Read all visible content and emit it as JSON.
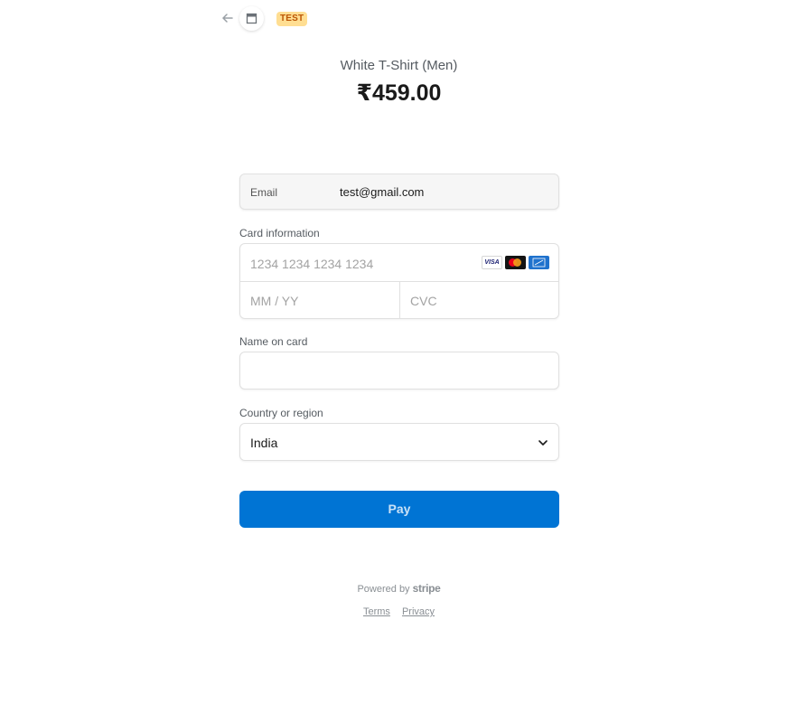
{
  "header": {
    "badge": "TEST"
  },
  "product": {
    "name": "White T-Shirt (Men)",
    "price": "₹459.00"
  },
  "email": {
    "label": "Email",
    "value": "test@gmail.com"
  },
  "card": {
    "label": "Card information",
    "number_placeholder": "1234 1234 1234 1234",
    "expiry_placeholder": "MM / YY",
    "cvc_placeholder": "CVC",
    "brands": [
      "visa",
      "mastercard",
      "amex"
    ],
    "visa_text": "VISA"
  },
  "name_on_card": {
    "label": "Name on card",
    "value": ""
  },
  "country": {
    "label": "Country or region",
    "selected": "India"
  },
  "pay_button": {
    "label": "Pay",
    "color": "#0074d4"
  },
  "footer": {
    "powered_by": "Powered by",
    "brand": "stripe",
    "terms": "Terms",
    "privacy": "Privacy"
  },
  "colors": {
    "test_badge_bg": "#ffde92",
    "test_badge_text": "#bb5504"
  }
}
